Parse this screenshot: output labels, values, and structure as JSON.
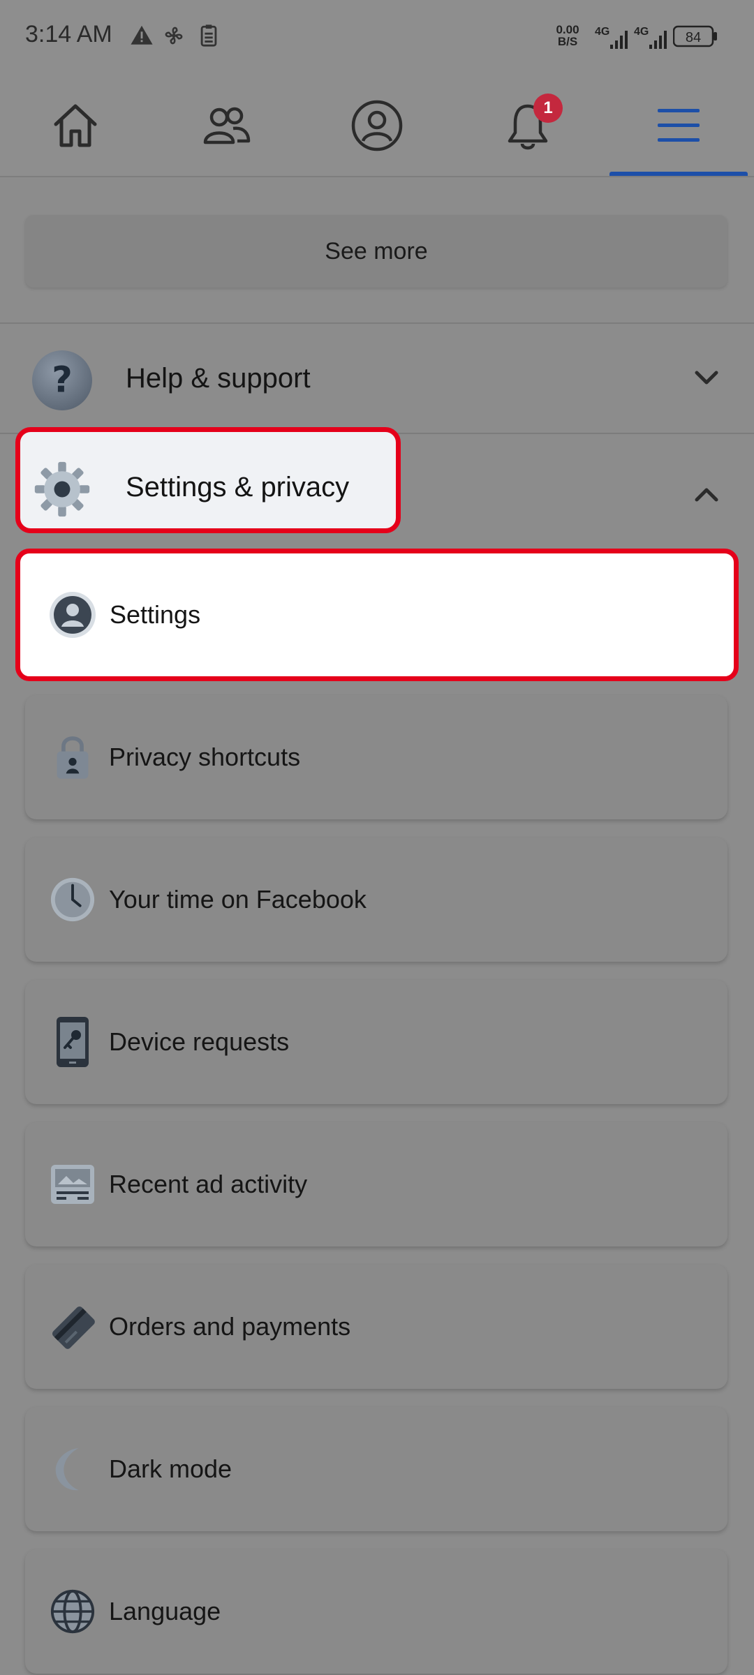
{
  "status_bar": {
    "time": "3:14 AM",
    "net_speed_value": "0.00",
    "net_speed_unit": "B/S",
    "network_1": "4G",
    "network_2": "4G",
    "battery": "84"
  },
  "top_nav": {
    "items": [
      {
        "name": "home",
        "icon": "home-icon"
      },
      {
        "name": "friends",
        "icon": "friends-icon"
      },
      {
        "name": "profile",
        "icon": "profile-icon"
      },
      {
        "name": "notifications",
        "icon": "bell-icon",
        "badge": "1"
      },
      {
        "name": "menu",
        "icon": "menu-icon",
        "active": true
      }
    ]
  },
  "see_more": {
    "label": "See more"
  },
  "sections": {
    "help": {
      "label": "Help & support",
      "icon": "question-icon",
      "expanded": false
    },
    "settings_privacy": {
      "label": "Settings & privacy",
      "icon": "gear-icon",
      "expanded": true
    }
  },
  "settings_items": [
    {
      "label": "Settings",
      "icon": "user-circle-icon"
    },
    {
      "label": "Privacy shortcuts",
      "icon": "lock-icon"
    },
    {
      "label": "Your time on Facebook",
      "icon": "clock-icon"
    },
    {
      "label": "Device requests",
      "icon": "phone-key-icon"
    },
    {
      "label": "Recent ad activity",
      "icon": "ad-icon"
    },
    {
      "label": "Orders and payments",
      "icon": "card-icon"
    },
    {
      "label": "Dark mode",
      "icon": "moon-icon"
    },
    {
      "label": "Language",
      "icon": "globe-icon"
    }
  ],
  "colors": {
    "highlight": "#e5001a",
    "accent": "#1d4fa8",
    "badge": "#c4283e"
  }
}
